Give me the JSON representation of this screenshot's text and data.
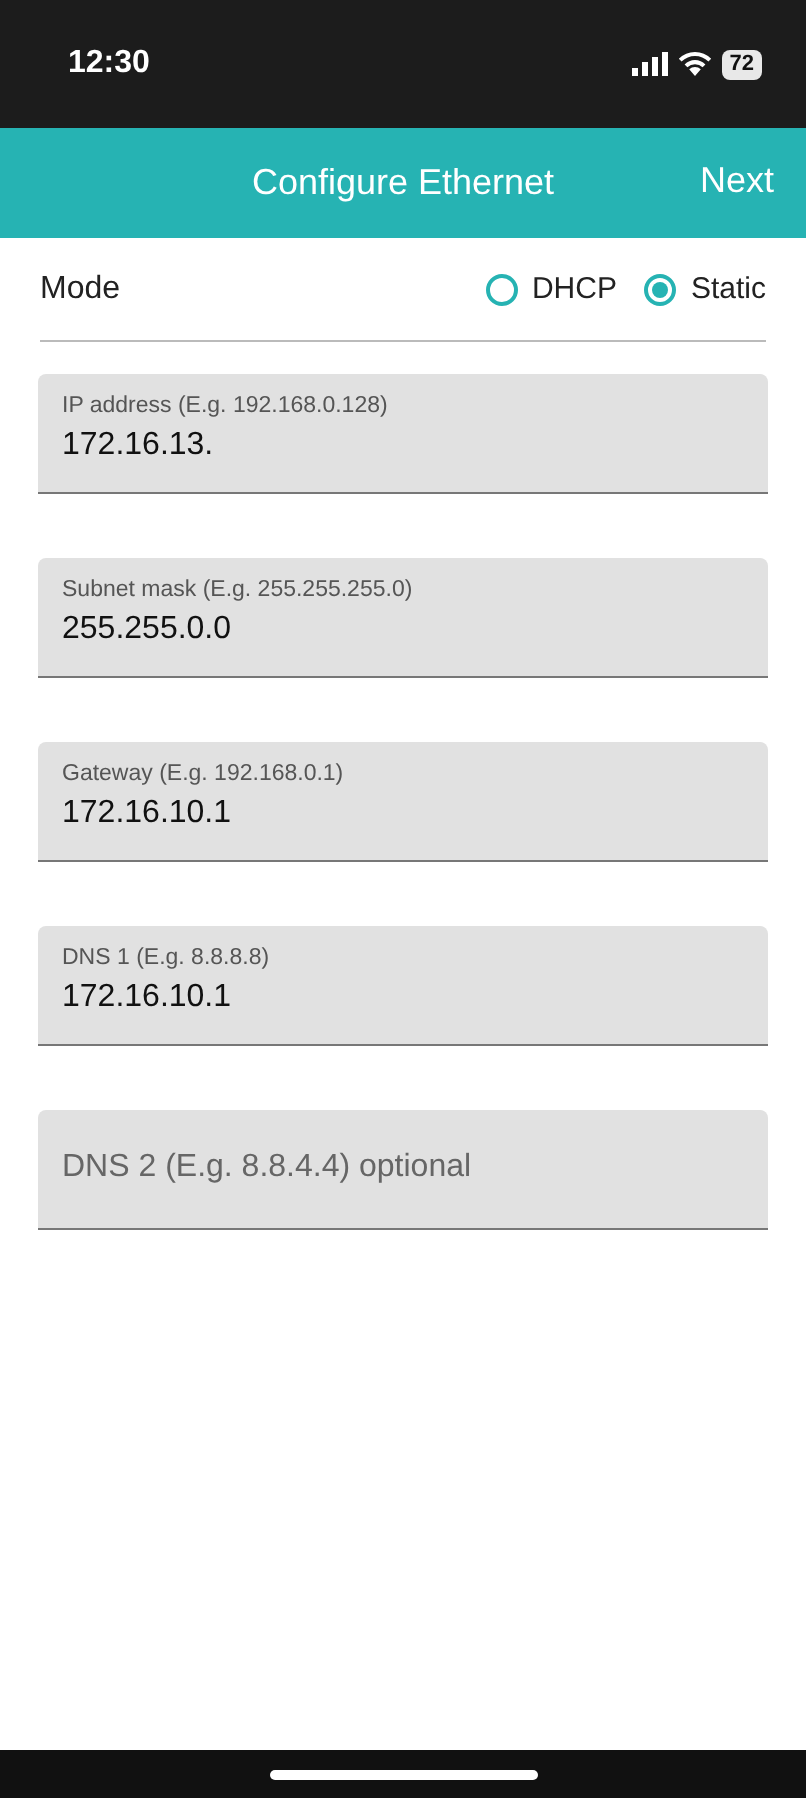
{
  "status_bar": {
    "time": "12:30",
    "battery": "72"
  },
  "header": {
    "title": "Configure Ethernet",
    "action": "Next"
  },
  "mode": {
    "label": "Mode",
    "options": [
      {
        "label": "DHCP",
        "selected": false
      },
      {
        "label": "Static",
        "selected": true
      }
    ]
  },
  "fields": [
    {
      "label": "IP address (E.g. 192.168.0.128)",
      "value": "172.16.13."
    },
    {
      "label": "Subnet mask (E.g. 255.255.255.0)",
      "value": "255.255.0.0"
    },
    {
      "label": "Gateway (E.g. 192.168.0.1)",
      "value": "172.16.10.1"
    },
    {
      "label": "DNS 1 (E.g. 8.8.8.8)",
      "value": "172.16.10.1"
    },
    {
      "placeholder": "DNS 2 (E.g. 8.8.4.4) optional"
    }
  ]
}
